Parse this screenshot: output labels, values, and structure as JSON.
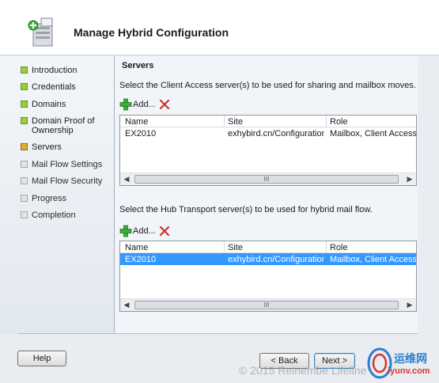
{
  "wizard": {
    "title": "Manage Hybrid Configuration",
    "icon": "hybrid-wizard-icon"
  },
  "steps": [
    {
      "label": "Introduction",
      "state": "complete"
    },
    {
      "label": "Credentials",
      "state": "complete"
    },
    {
      "label": "Domains",
      "state": "complete"
    },
    {
      "label": "Domain Proof of Ownership",
      "state": "complete"
    },
    {
      "label": "Servers",
      "state": "current"
    },
    {
      "label": "Mail Flow Settings",
      "state": "pending"
    },
    {
      "label": "Mail Flow Security",
      "state": "pending"
    },
    {
      "label": "Progress",
      "state": "pending"
    },
    {
      "label": "Completion",
      "state": "pending"
    }
  ],
  "page": {
    "section_title": "Servers",
    "cas": {
      "instruction": "Select the Client Access server(s) to be used for sharing and mailbox moves.",
      "add_label": "Add...",
      "columns": [
        "Name",
        "Site",
        "Role"
      ],
      "rows": [
        {
          "name": "EX2010",
          "site": "exhybird.cn/Configuration/...",
          "role": "Mailbox, Client Access, Hu",
          "selected": false
        }
      ],
      "scroll_grip": "III"
    },
    "hub": {
      "instruction": "Select the Hub Transport server(s) to be used for hybrid mail flow.",
      "add_label": "Add...",
      "columns": [
        "Name",
        "Site",
        "Role"
      ],
      "rows": [
        {
          "name": "EX2010",
          "site": "exhybird.cn/Configuration/...",
          "role": "Mailbox, Client Access, Hu",
          "selected": true
        }
      ],
      "scroll_grip": "III"
    }
  },
  "buttons": {
    "help": "Help",
    "back": "< Back",
    "next": "Next >"
  },
  "watermark": {
    "copyright": "© 2015 Reinembe  Lifeline",
    "logo_cn": "运维网",
    "logo_url": "iyunv.com"
  },
  "colors": {
    "complete": "#9ccb3b",
    "current": "#e2ae2f",
    "pending": "#e4e4e4",
    "selection": "#3399ff"
  }
}
